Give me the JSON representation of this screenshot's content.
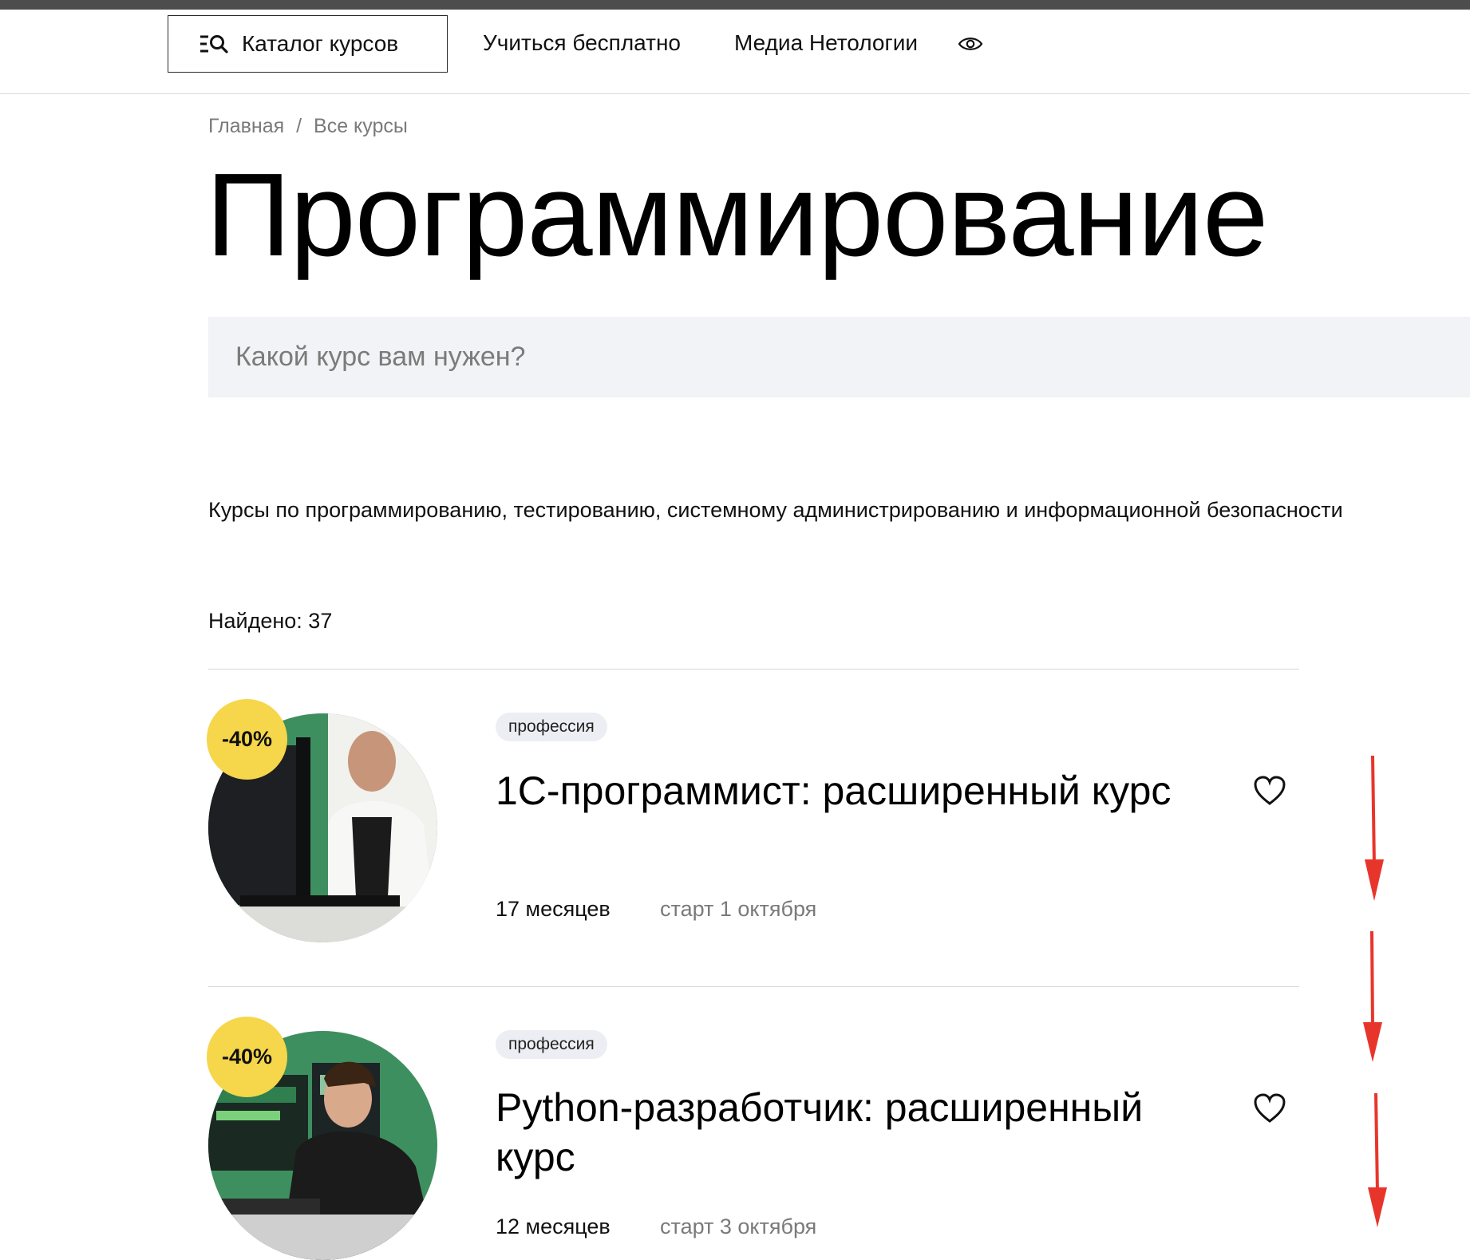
{
  "header": {
    "catalog_label": "Каталог курсов",
    "nav": [
      "Учиться бесплатно",
      "Медиа Нетологии"
    ]
  },
  "breadcrumb": {
    "home": "Главная",
    "separator": "/",
    "current": "Все курсы"
  },
  "page": {
    "title": "Программирование",
    "description": "Курсы по программированию, тестированию, системному администрированию и информационной безопасности"
  },
  "search": {
    "placeholder": "Какой курс вам нужен?",
    "value": ""
  },
  "results": {
    "found_label": "Найдено: 37"
  },
  "courses": [
    {
      "badge": "-40%",
      "tag": "профессия",
      "title": "1С-программист: расширенный курс",
      "duration": "17 месяцев",
      "start": "старт 1 октября"
    },
    {
      "badge": "-40%",
      "tag": "профессия",
      "title": "Python-разработчик: расширенный курс",
      "duration": "12 месяцев",
      "start": "старт 3 октября"
    }
  ],
  "colors": {
    "discount_badge": "#F6D64A",
    "search_bg": "#F2F3F6",
    "annotation_arrow": "#E8352B",
    "image_bg_green": "#3E8F5F"
  },
  "icons": {
    "catalog": "catalog-search-icon",
    "eye": "eye-icon",
    "favorite": "heart-icon",
    "annotation": "red-arrow-down"
  }
}
